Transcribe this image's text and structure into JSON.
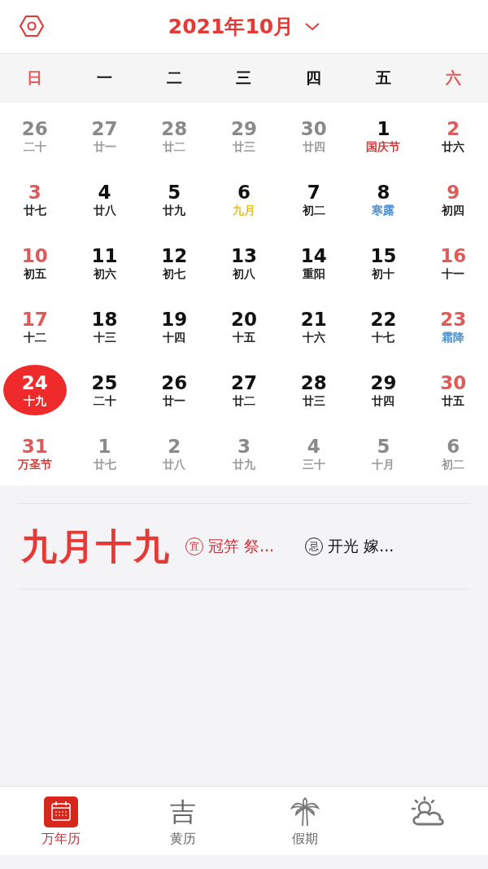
{
  "header": {
    "title": "2021年10月"
  },
  "weekdays": [
    {
      "label": "日",
      "weekend": true
    },
    {
      "label": "一",
      "weekend": false
    },
    {
      "label": "二",
      "weekend": false
    },
    {
      "label": "三",
      "weekend": false
    },
    {
      "label": "四",
      "weekend": false
    },
    {
      "label": "五",
      "weekend": false
    },
    {
      "label": "六",
      "weekend": true
    }
  ],
  "days": [
    {
      "day": "26",
      "lunar": "二十",
      "other_month": true,
      "selected": false
    },
    {
      "day": "27",
      "lunar": "廿一",
      "other_month": true,
      "selected": false
    },
    {
      "day": "28",
      "lunar": "廿二",
      "other_month": true,
      "selected": false
    },
    {
      "day": "29",
      "lunar": "廿三",
      "other_month": true,
      "selected": false
    },
    {
      "day": "30",
      "lunar": "廿四",
      "other_month": true,
      "selected": false
    },
    {
      "day": "1",
      "lunar": "国庆节",
      "other_month": false,
      "weekend": false,
      "color": "#d03c3c",
      "selected": false
    },
    {
      "day": "2",
      "lunar": "廿六",
      "other_month": false,
      "weekend": true,
      "color": "#222222",
      "selected": false
    },
    {
      "day": "3",
      "lunar": "廿七",
      "other_month": false,
      "weekend": true,
      "color": "#222222",
      "selected": false
    },
    {
      "day": "4",
      "lunar": "廿八",
      "other_month": false,
      "weekend": false,
      "color": "#222222",
      "selected": false
    },
    {
      "day": "5",
      "lunar": "廿九",
      "other_month": false,
      "weekend": false,
      "color": "#222222",
      "selected": false
    },
    {
      "day": "6",
      "lunar": "九月",
      "other_month": false,
      "weekend": false,
      "color": "#e8c020",
      "selected": false
    },
    {
      "day": "7",
      "lunar": "初二",
      "other_month": false,
      "weekend": false,
      "color": "#222222",
      "selected": false
    },
    {
      "day": "8",
      "lunar": "寒露",
      "other_month": false,
      "weekend": false,
      "color": "#4a90d0",
      "selected": false
    },
    {
      "day": "9",
      "lunar": "初四",
      "other_month": false,
      "weekend": true,
      "color": "#222222",
      "selected": false
    },
    {
      "day": "10",
      "lunar": "初五",
      "other_month": false,
      "weekend": true,
      "color": "#222222",
      "selected": false
    },
    {
      "day": "11",
      "lunar": "初六",
      "other_month": false,
      "weekend": false,
      "color": "#222222",
      "selected": false
    },
    {
      "day": "12",
      "lunar": "初七",
      "other_month": false,
      "weekend": false,
      "color": "#222222",
      "selected": false
    },
    {
      "day": "13",
      "lunar": "初八",
      "other_month": false,
      "weekend": false,
      "color": "#222222",
      "selected": false
    },
    {
      "day": "14",
      "lunar": "重阳",
      "other_month": false,
      "weekend": false,
      "color": "#222222",
      "selected": false
    },
    {
      "day": "15",
      "lunar": "初十",
      "other_month": false,
      "weekend": false,
      "color": "#222222",
      "selected": false
    },
    {
      "day": "16",
      "lunar": "十一",
      "other_month": false,
      "weekend": true,
      "color": "#222222",
      "selected": false
    },
    {
      "day": "17",
      "lunar": "十二",
      "other_month": false,
      "weekend": true,
      "color": "#222222",
      "selected": false
    },
    {
      "day": "18",
      "lunar": "十三",
      "other_month": false,
      "weekend": false,
      "color": "#222222",
      "selected": false
    },
    {
      "day": "19",
      "lunar": "十四",
      "other_month": false,
      "weekend": false,
      "color": "#222222",
      "selected": false
    },
    {
      "day": "20",
      "lunar": "十五",
      "other_month": false,
      "weekend": false,
      "color": "#222222",
      "selected": false
    },
    {
      "day": "21",
      "lunar": "十六",
      "other_month": false,
      "weekend": false,
      "color": "#222222",
      "selected": false
    },
    {
      "day": "22",
      "lunar": "十七",
      "other_month": false,
      "weekend": false,
      "color": "#222222",
      "selected": false
    },
    {
      "day": "23",
      "lunar": "霜降",
      "other_month": false,
      "weekend": true,
      "color": "#4a90d0",
      "selected": false
    },
    {
      "day": "24",
      "lunar": "十九",
      "selected": true
    },
    {
      "day": "25",
      "lunar": "二十",
      "other_month": false,
      "weekend": false,
      "color": "#222222",
      "selected": false
    },
    {
      "day": "26",
      "lunar": "廿一",
      "other_month": false,
      "weekend": false,
      "color": "#222222",
      "selected": false
    },
    {
      "day": "27",
      "lunar": "廿二",
      "other_month": false,
      "weekend": false,
      "color": "#222222",
      "selected": false
    },
    {
      "day": "28",
      "lunar": "廿三",
      "other_month": false,
      "weekend": false,
      "color": "#222222",
      "selected": false
    },
    {
      "day": "29",
      "lunar": "廿四",
      "other_month": false,
      "weekend": false,
      "color": "#222222",
      "selected": false
    },
    {
      "day": "30",
      "lunar": "廿五",
      "other_month": false,
      "weekend": true,
      "color": "#222222",
      "selected": false
    },
    {
      "day": "31",
      "lunar": "万圣节",
      "other_month": false,
      "weekend": true,
      "color": "#d03c3c",
      "selected": false
    },
    {
      "day": "1",
      "lunar": "廿七",
      "other_month": true,
      "selected": false
    },
    {
      "day": "2",
      "lunar": "廿八",
      "other_month": true,
      "selected": false
    },
    {
      "day": "3",
      "lunar": "廿九",
      "other_month": true,
      "selected": false
    },
    {
      "day": "4",
      "lunar": "三十",
      "other_month": true,
      "selected": false
    },
    {
      "day": "5",
      "lunar": "十月",
      "other_month": true,
      "selected": false
    },
    {
      "day": "6",
      "lunar": "初二",
      "other_month": true,
      "selected": false
    }
  ],
  "detail": {
    "lunar_date": "九月十九",
    "good": {
      "mark": "宜",
      "text": "冠笄 祭..."
    },
    "bad": {
      "mark": "忌",
      "text": "开光 嫁..."
    }
  },
  "tabs": [
    {
      "kind": "calendar",
      "label": "万年历",
      "selected": true
    },
    {
      "kind": "char",
      "icon_char": "吉",
      "label": "黄历",
      "selected": false
    },
    {
      "kind": "palm",
      "label": "假期",
      "selected": false
    },
    {
      "kind": "weather",
      "selected": false
    }
  ]
}
